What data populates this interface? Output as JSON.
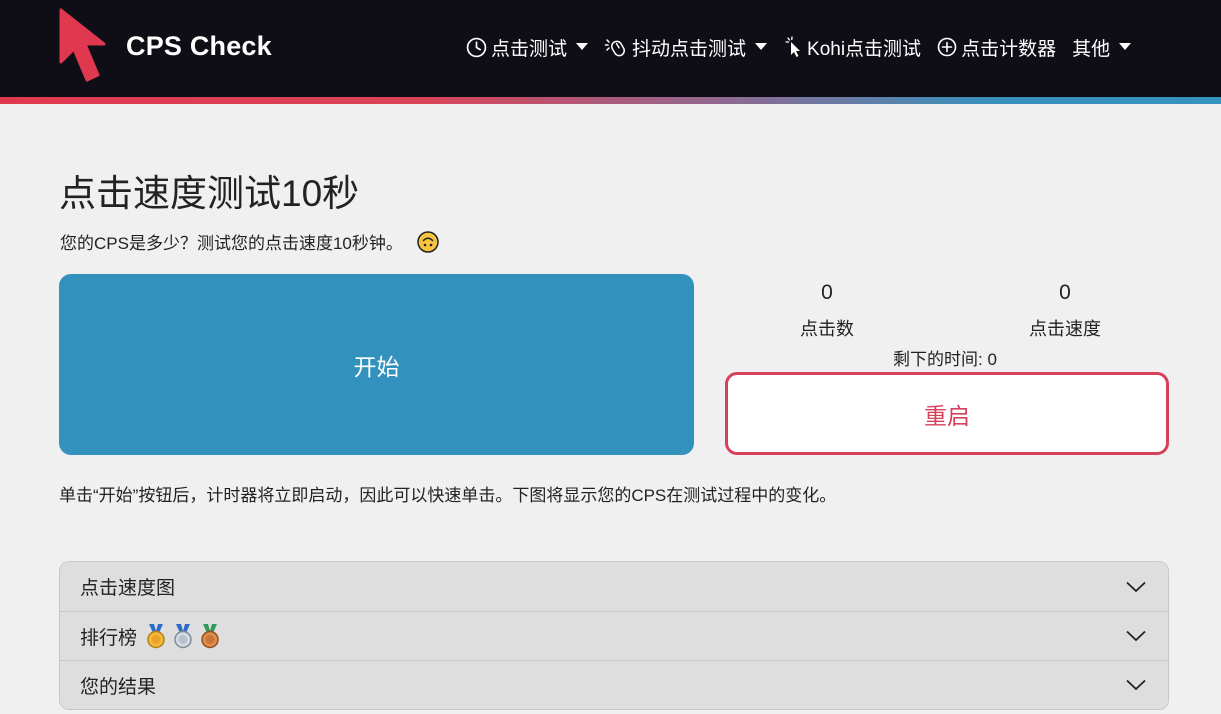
{
  "brand": {
    "name": "CPS Check"
  },
  "nav": {
    "items": [
      {
        "label": "点击测试",
        "icon": "clock-icon",
        "dropdown": true
      },
      {
        "label": "抖动点击测试",
        "icon": "mouse-vibrate-icon",
        "dropdown": true
      },
      {
        "label": "Kohi点击测试",
        "icon": "cursor-click-icon",
        "dropdown": false
      },
      {
        "label": "点击计数器",
        "icon": "plus-circle-icon",
        "dropdown": false
      },
      {
        "label": "其他",
        "icon": "",
        "dropdown": true
      }
    ]
  },
  "page": {
    "title": "点击速度测试10秒",
    "subtitle": "您的CPS是多少？测试您的点击速度10秒钟。",
    "subtitle_emoji": "upside-down-face-icon",
    "description": "单击“开始”按钮后，计时器将立即启动，因此可以快速单击。下图将显示您的CPS在测试过程中的变化。"
  },
  "test": {
    "start_label": "开始",
    "restart_label": "重启",
    "clicks_value": "0",
    "clicks_label": "点击数",
    "speed_value": "0",
    "speed_label": "点击速度",
    "remaining_label": "剩下的时间: 0"
  },
  "accordion": {
    "items": [
      {
        "title": "点击速度图"
      },
      {
        "title": "排行榜",
        "medals": [
          "gold-medal-icon",
          "silver-medal-icon",
          "bronze-medal-icon"
        ]
      },
      {
        "title": "您的结果"
      }
    ]
  },
  "colors": {
    "navbar_bg": "#0f0e17",
    "brand_red": "#e0384f",
    "start_blue": "#3392bd",
    "restart_red": "#d7405a",
    "page_bg": "#f0f0f0",
    "accordion_bg": "#dedede"
  }
}
